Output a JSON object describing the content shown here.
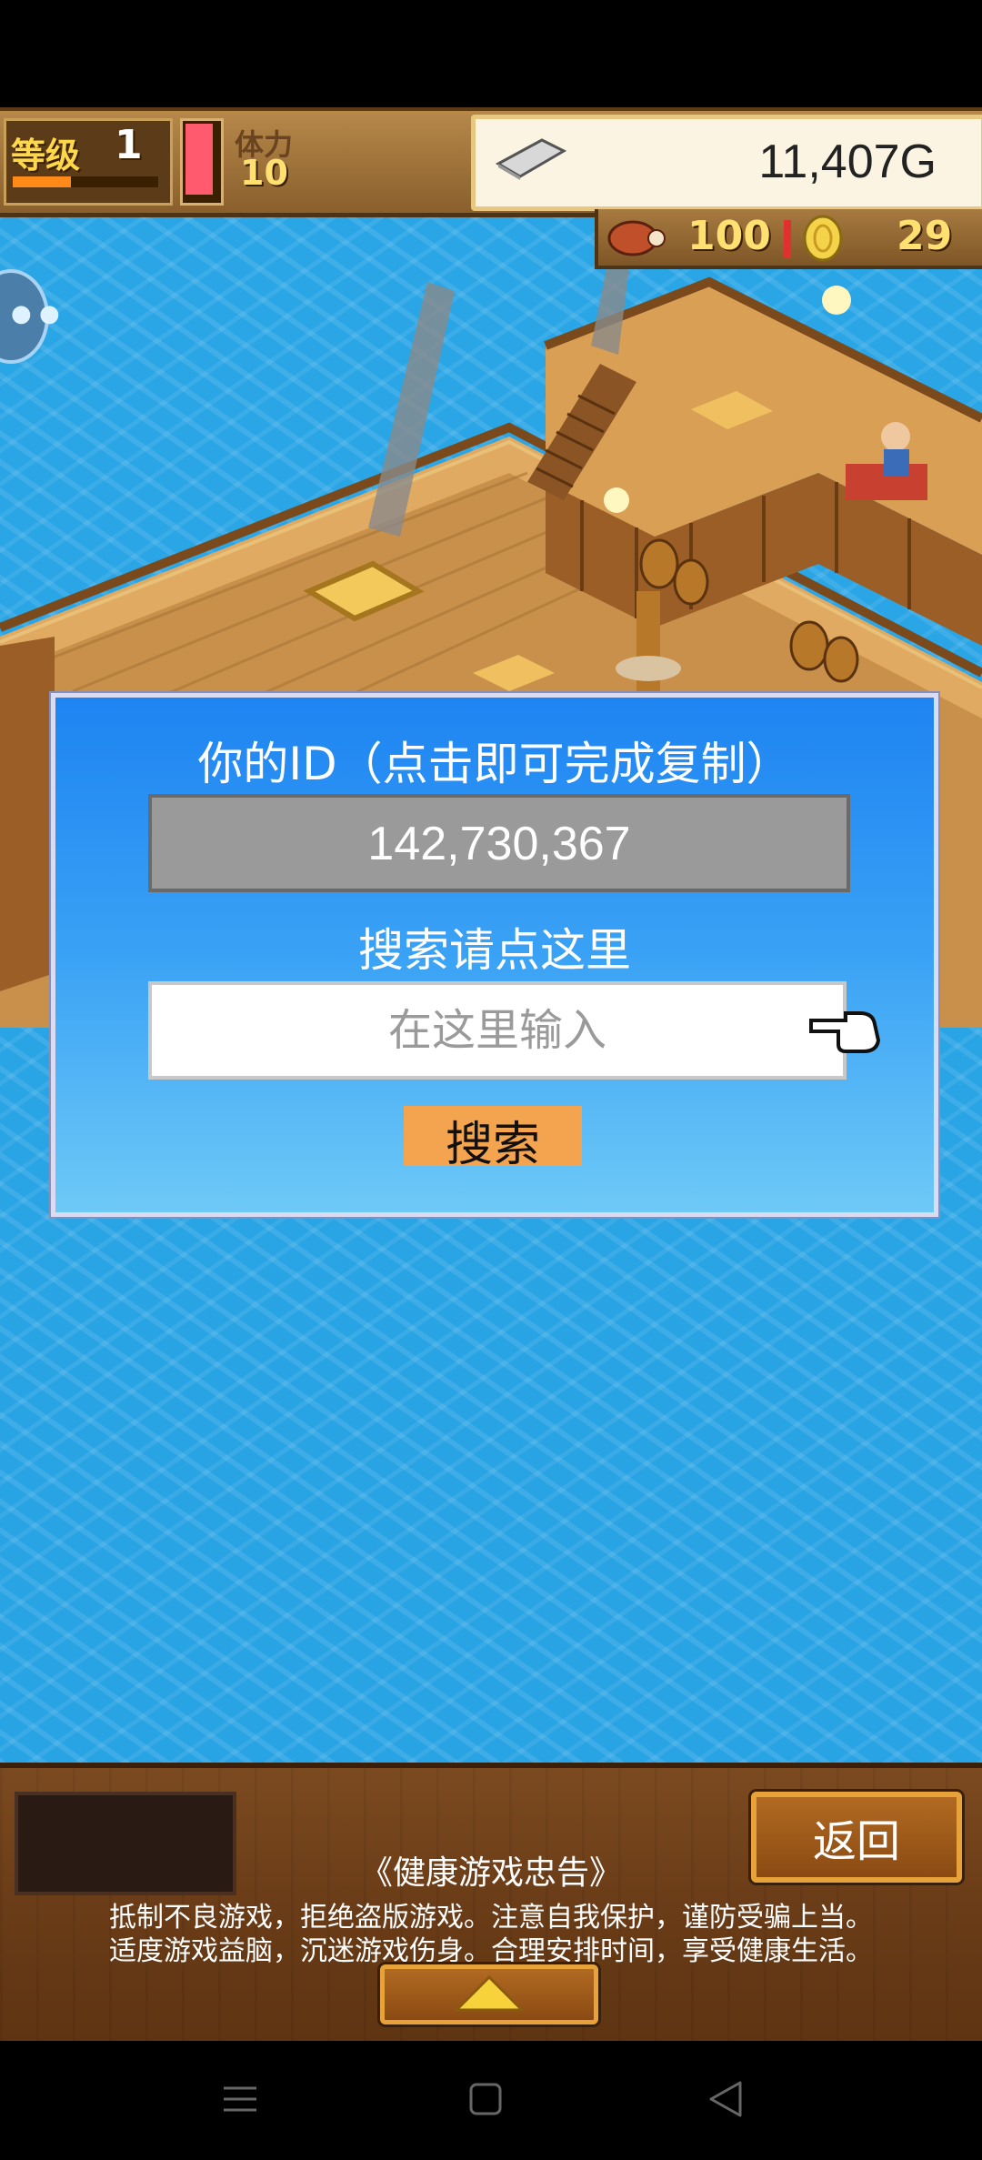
{
  "hud": {
    "level_label": "等级",
    "level_value": "1",
    "level_progress": 0.4,
    "stamina_label": "体力",
    "stamina_value": "10",
    "gold_value": "11,407G",
    "meat_value": "100",
    "coin_value": "29"
  },
  "dialog": {
    "title": "你的ID（点击即可完成复制）",
    "id_value": "142,730,367",
    "search_hint": "搜索请点这里",
    "search_placeholder": "在这里输入",
    "search_button_label": "搜索"
  },
  "bottom": {
    "back_label": "返回",
    "advisory_title": "《健康游戏忠告》",
    "advisory_line1": "抵制不良游戏，拒绝盗版游戏。注意自我保护，谨防受骗上当。",
    "advisory_line2": "适度游戏益脑，沉迷游戏伤身。合理安排时间，享受健康生活。"
  },
  "colors": {
    "ocean": "#2aa6e6",
    "dialog_top": "#1e84f2",
    "dialog_bottom": "#6ec9f7",
    "search_button": "#f4a44e",
    "wood": "#6a3c17"
  },
  "icons": [
    "silver-bar-icon",
    "meat-icon",
    "coin-icon",
    "chat-bubble-icon",
    "pointer-hand-icon",
    "expand-arrow-icon",
    "nav-menu-icon",
    "nav-home-icon",
    "nav-back-icon"
  ]
}
